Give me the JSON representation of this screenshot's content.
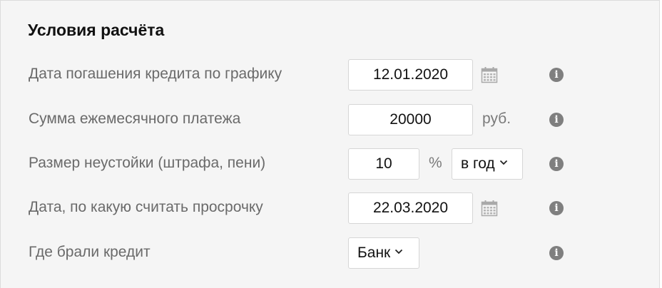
{
  "section": {
    "title": "Условия расчёта"
  },
  "rows": {
    "repay_date": {
      "label": "Дата погашения кредита по графику",
      "value": "12.01.2020",
      "icon": "calendar-icon",
      "info_icon": "info-icon"
    },
    "monthly_payment": {
      "label": "Сумма ежемесячного платежа",
      "value": "20000",
      "unit": "руб.",
      "info_icon": "info-icon"
    },
    "penalty": {
      "label": "Размер неустойки (штрафа, пени)",
      "value": "10",
      "unit": "%",
      "period_selected": "в год",
      "info_icon": "info-icon"
    },
    "overdue_date": {
      "label": "Дата, по какую считать просрочку",
      "value": "22.03.2020",
      "icon": "calendar-icon",
      "info_icon": "info-icon"
    },
    "lender": {
      "label": "Где брали кредит",
      "selected": "Банк",
      "info_icon": "info-icon"
    }
  },
  "colors": {
    "panel_bg": "#f5f5f5",
    "label": "#6a6a6a",
    "info_icon_bg": "#7f7f7f"
  }
}
